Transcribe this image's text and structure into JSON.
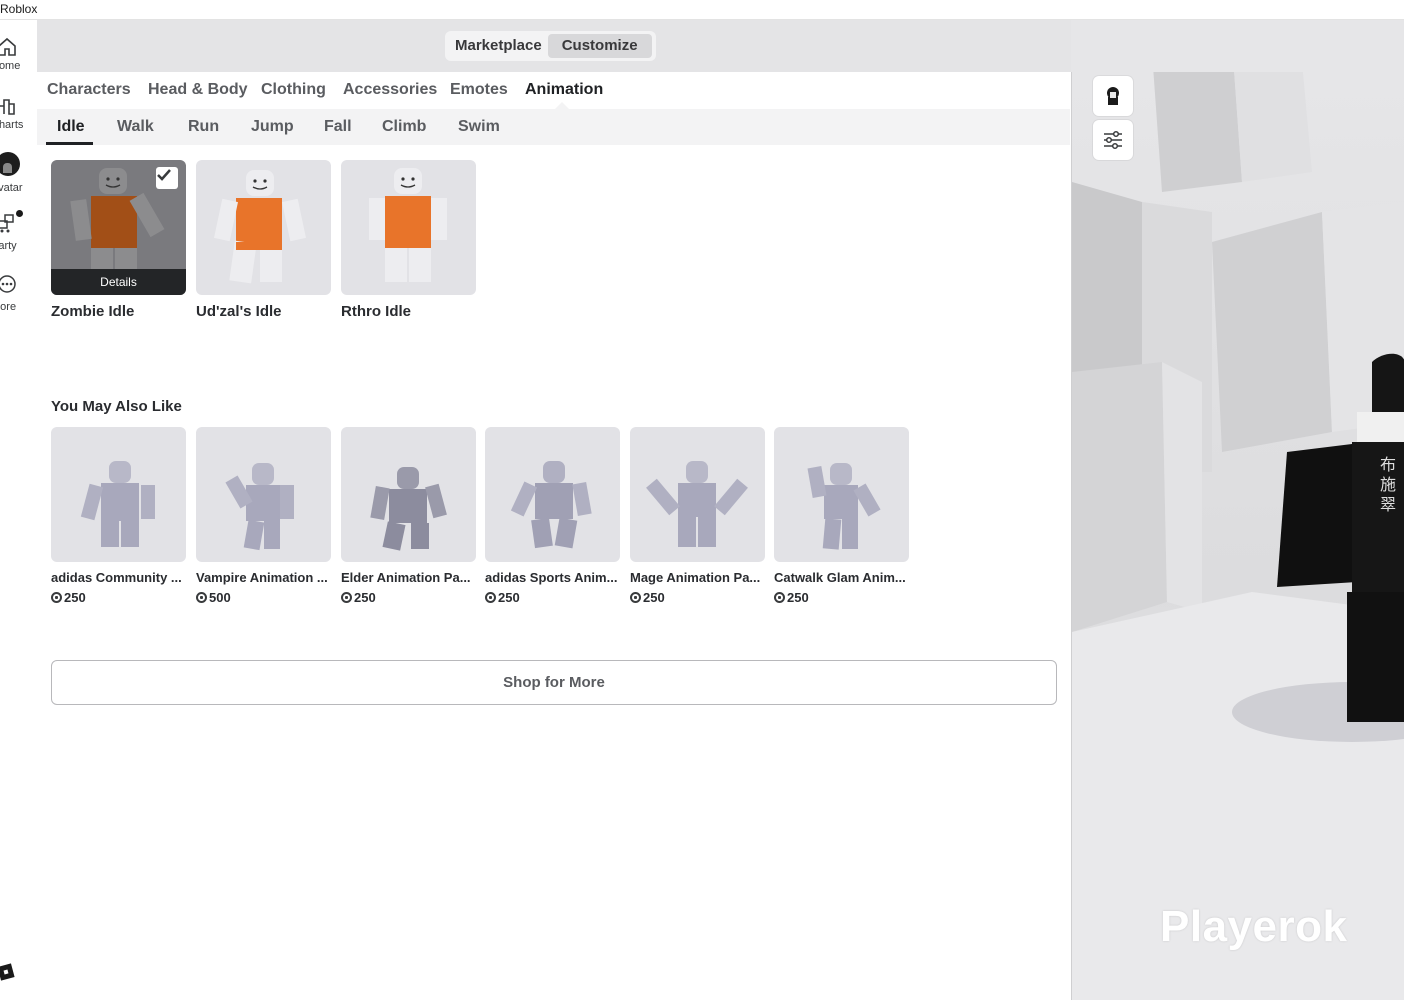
{
  "window": {
    "title": "Roblox"
  },
  "nav": {
    "items": [
      {
        "label": "Home",
        "icon": "home-icon"
      },
      {
        "label": "Charts",
        "icon": "charts-icon"
      },
      {
        "label": "Avatar",
        "icon": "avatar-icon"
      },
      {
        "label": "Party",
        "icon": "party-icon"
      },
      {
        "label": "More",
        "icon": "more-icon"
      }
    ]
  },
  "segment": {
    "marketplace": "Marketplace",
    "customize": "Customize",
    "selected": "Customize"
  },
  "category_tabs": [
    "Characters",
    "Head & Body",
    "Clothing",
    "Accessories",
    "Emotes",
    "Animation"
  ],
  "active_category": "Animation",
  "sub_tabs": [
    "Idle",
    "Walk",
    "Run",
    "Jump",
    "Fall",
    "Climb",
    "Swim"
  ],
  "active_sub_tab": "Idle",
  "owned": {
    "details_label": "Details",
    "items": [
      {
        "name": "Zombie Idle",
        "selected": true
      },
      {
        "name": "Ud'zal's Idle",
        "selected": false
      },
      {
        "name": "Rthro Idle",
        "selected": false
      }
    ]
  },
  "recommendations": {
    "title": "You May Also Like",
    "items": [
      {
        "name": "adidas Community ...",
        "price": "250"
      },
      {
        "name": "Vampire Animation ...",
        "price": "500"
      },
      {
        "name": "Elder Animation Pa...",
        "price": "250"
      },
      {
        "name": "adidas Sports Anim...",
        "price": "250"
      },
      {
        "name": "Mage Animation Pa...",
        "price": "250"
      },
      {
        "name": "Catwalk Glam Anim...",
        "price": "250"
      }
    ]
  },
  "shop_button": "Shop for More",
  "preview": {
    "watermark": "Playerok",
    "shirt_text": "布施翠"
  },
  "colors": {
    "accent": "#1f2124",
    "tile_bg": "#e2e2e6",
    "orange": "#e8742a"
  }
}
